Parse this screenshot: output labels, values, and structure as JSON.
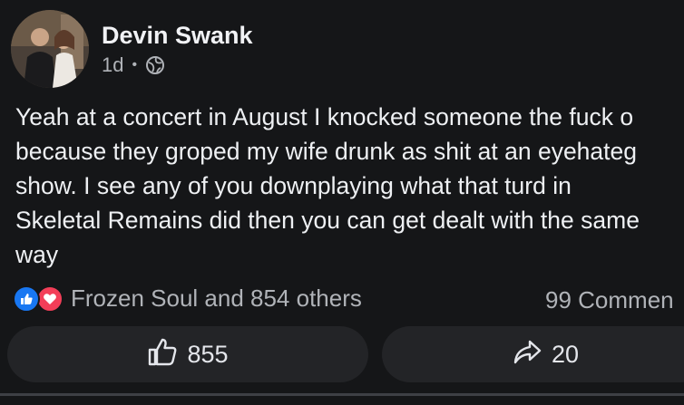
{
  "post": {
    "author": "Devin Swank",
    "time": "1d",
    "separator": "•",
    "privacy_icon": "globe-icon",
    "text": "Yeah at a concert in August I knocked someone the fuck o\nbecause they groped my wife drunk as shit at an eyehateg\nshow. I see any of you downplaying what that turd in\nSkeletal Remains did then you can get dealt with the same\nway"
  },
  "reactions": {
    "icons": [
      "like-icon",
      "love-icon"
    ],
    "summary": "Frozen Soul and 854 others",
    "comments": "99 Commen"
  },
  "actions": {
    "like_count": "855",
    "share_count": "20"
  },
  "colors": {
    "background": "#151618",
    "like_blue": "#1877f2",
    "love_red": "#f33e58",
    "button_bg": "#232427",
    "muted_text": "#b0b3b8"
  }
}
